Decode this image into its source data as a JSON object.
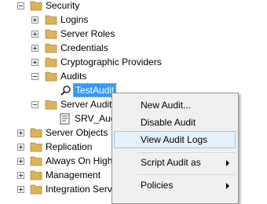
{
  "tree": {
    "security": "Security",
    "logins": "Logins",
    "server_roles": "Server Roles",
    "credentials": "Credentials",
    "crypto_providers": "Cryptographic Providers",
    "audits": "Audits",
    "test_audit": "TestAudit",
    "server_audit_specs": "Server Audit",
    "srv_audit": "SRV_Aud",
    "server_objects": "Server Objects",
    "replication": "Replication",
    "always_on": "Always On High",
    "management": "Management",
    "integration_services": "Integration Servi"
  },
  "context_menu": {
    "new_audit": "New Audit...",
    "disable_audit": "Disable Audit",
    "view_audit_logs": "View Audit Logs",
    "script_audit_as": "Script Audit as",
    "policies": "Policies"
  },
  "colors": {
    "selection": "#3399ff",
    "folder": "#dcb25a",
    "hover": "#e5f1fb"
  }
}
